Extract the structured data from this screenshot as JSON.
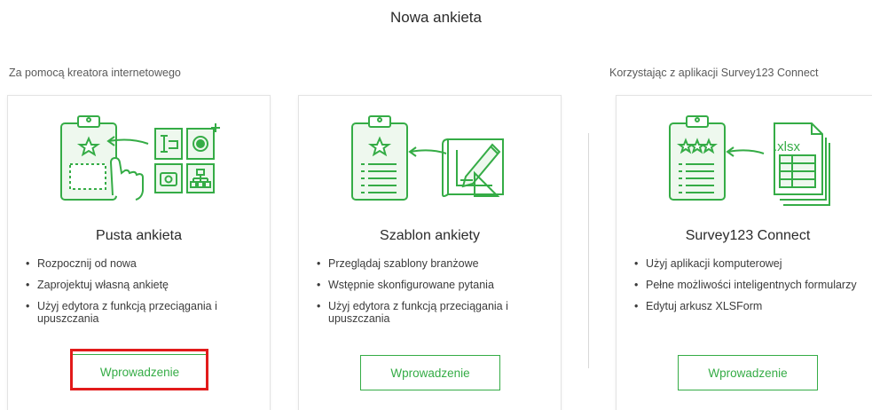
{
  "page": {
    "title": "Nowa ankieta"
  },
  "sections": {
    "web": "Za pomocą kreatora internetowego",
    "connect": "Korzystając z aplikacji Survey123 Connect"
  },
  "cards": [
    {
      "title": "Pusta ankieta",
      "bullets": [
        "Rozpocznij od nowa",
        "Zaprojektuj własną ankietę",
        "Użyj edytora z funkcją przeciągania i upuszczania"
      ],
      "button": "Wprowadzenie",
      "illustration": "blank-survey-icon"
    },
    {
      "title": "Szablon ankiety",
      "bullets": [
        "Przeglądaj szablony branżowe",
        "Wstępnie skonfigurowane pytania",
        "Użyj edytora z funkcją przeciągania i upuszczania"
      ],
      "button": "Wprowadzenie",
      "illustration": "survey-template-icon"
    },
    {
      "title": "Survey123 Connect",
      "bullets": [
        "Użyj aplikacji komputerowej",
        "Pełne możliwości inteligentnych formularzy",
        "Edytuj arkusz XLSForm"
      ],
      "button": "Wprowadzenie",
      "illustration": "xlsform-icon",
      "file_label": ".xlsx"
    }
  ],
  "colors": {
    "accent": "#35ac46",
    "highlight": "#e21b1b"
  }
}
